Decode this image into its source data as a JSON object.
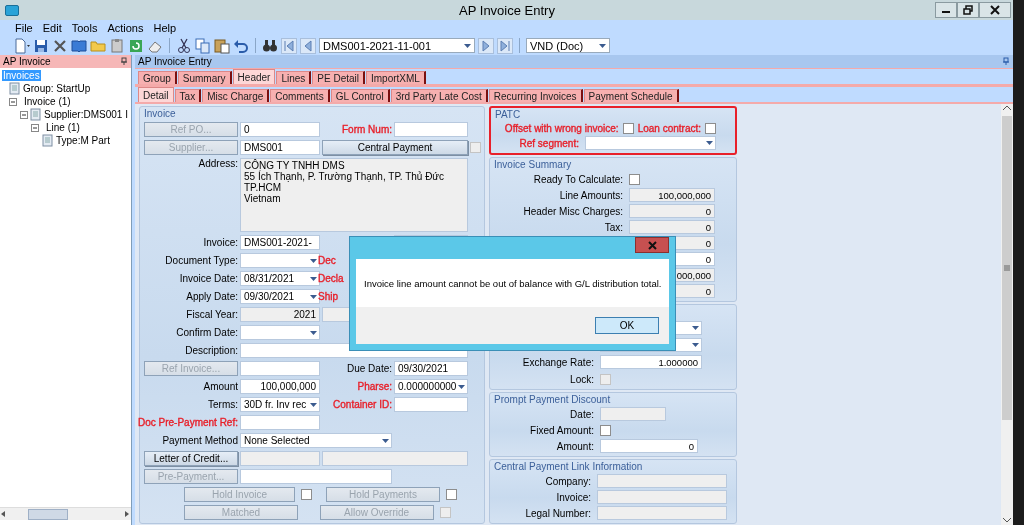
{
  "window": {
    "title": "AP Invoice Entry"
  },
  "menu": [
    "File",
    "Edit",
    "Tools",
    "Actions",
    "Help"
  ],
  "toolbar": {
    "record": "DMS001-2021-11-001",
    "currency": "VND (Doc)"
  },
  "tree_panel": {
    "title": "AP Invoice",
    "items": [
      {
        "label": "Invoices",
        "selected": true,
        "children": [
          {
            "label": "Group: StartUp",
            "kind": "record",
            "selected": false
          },
          {
            "label": "Invoice (1)",
            "kind": "group",
            "selected": false,
            "expanded": true,
            "children": [
              {
                "label": "Supplier:DMS001 I",
                "kind": "record",
                "selected": false,
                "expanded": true,
                "children": [
                  {
                    "label": "Line (1)",
                    "kind": "group",
                    "selected": false,
                    "expanded": true,
                    "children": [
                      {
                        "label": "Type:M Part",
                        "kind": "record",
                        "selected": false
                      }
                    ]
                  }
                ]
              }
            ]
          }
        ]
      }
    ]
  },
  "main": {
    "title": "AP Invoice Entry",
    "tabs": [
      {
        "label": "Group",
        "selected": false
      },
      {
        "label": "Summary",
        "selected": false
      },
      {
        "label": "Header",
        "selected": true
      },
      {
        "label": "Lines",
        "selected": false
      },
      {
        "label": "PE Detail",
        "selected": false
      },
      {
        "label": "ImportXML",
        "selected": false
      }
    ],
    "subtabs": [
      {
        "label": "Detail",
        "selected": true
      },
      {
        "label": "Tax",
        "selected": false
      },
      {
        "label": "Misc Charge",
        "selected": false
      },
      {
        "label": "Comments",
        "selected": false
      },
      {
        "label": "GL Control",
        "selected": false
      },
      {
        "label": "3rd Party Late Cost",
        "selected": false
      },
      {
        "label": "Recurring Invoices",
        "selected": false
      },
      {
        "label": "Payment Schedule",
        "selected": false
      }
    ],
    "invoice_group": {
      "title": "Invoice",
      "rows": [
        {
          "kind": "fields",
          "cells": [
            {
              "kind": "button",
              "text": "Ref PO...",
              "disabled": true
            },
            {
              "kind": "field",
              "value": "0"
            },
            {
              "kind": "label",
              "text": "Form Num:",
              "color": "#e8202a"
            },
            {
              "kind": "field"
            }
          ]
        },
        {
          "kind": "fields",
          "cells": [
            {
              "kind": "button",
              "text": "Supplier...",
              "disabled": true
            },
            {
              "kind": "field",
              "value": "DMS001"
            },
            {
              "kind": "button",
              "text": "Central Payment",
              "disabled": false
            },
            {
              "kind": "checkbox",
              "checked": false,
              "disabled": true
            }
          ]
        },
        {
          "kind": "fields",
          "cells": [
            {
              "kind": "label",
              "text": "Address:"
            },
            {
              "kind": "textarea",
              "lines": [
                "CÔNG TY TNHH DMS",
                "55 Ích Thạnh, P. Trường Thạnh, TP. Thủ Đức",
                "TP.HCM",
                "Vietnam"
              ]
            }
          ]
        },
        {
          "kind": "fields",
          "cells": [
            {
              "kind": "label",
              "text": "Invoice:"
            },
            {
              "kind": "field",
              "value": "DMS001-2021-"
            },
            {
              "kind": "far_field"
            }
          ]
        },
        {
          "kind": "fields",
          "cells": [
            {
              "kind": "label",
              "text": "Document Type:"
            },
            {
              "kind": "combo"
            },
            {
              "kind": "partial_label",
              "text": "Dec",
              "color": "#e8202a"
            }
          ]
        },
        {
          "kind": "fields",
          "cells": [
            {
              "kind": "label",
              "text": "Invoice Date:"
            },
            {
              "kind": "combo",
              "value": "08/31/2021"
            },
            {
              "kind": "partial_label",
              "text": "Decla",
              "color": "#e8202a"
            }
          ]
        },
        {
          "kind": "fields",
          "cells": [
            {
              "kind": "label",
              "text": "Apply Date:"
            },
            {
              "kind": "combo",
              "value": "09/30/2021"
            },
            {
              "kind": "partial_label",
              "text": "Ship",
              "color": "#e8202a"
            }
          ]
        },
        {
          "kind": "fields",
          "cells": [
            {
              "kind": "label",
              "text": "Fiscal Year:"
            },
            {
              "kind": "number_field",
              "value": "2021",
              "disabled": true
            },
            {
              "kind": "field",
              "disabled": true
            }
          ]
        },
        {
          "kind": "fields",
          "cells": [
            {
              "kind": "label",
              "text": "Confirm Date:"
            },
            {
              "kind": "combo"
            }
          ]
        },
        {
          "kind": "fields",
          "cells": [
            {
              "kind": "label",
              "text": "Description:"
            },
            {
              "kind": "wide_field"
            }
          ]
        },
        {
          "kind": "fields",
          "cells": [
            {
              "kind": "button",
              "text": "Ref Invoice...",
              "disabled": true
            },
            {
              "kind": "field"
            },
            {
              "kind": "label",
              "text": "Due Date:"
            },
            {
              "kind": "field",
              "value": "09/30/2021"
            }
          ]
        },
        {
          "kind": "fields",
          "cells": [
            {
              "kind": "label",
              "text": "Amount"
            },
            {
              "kind": "number_field",
              "value": "100,000,000"
            },
            {
              "kind": "label",
              "text": "Pharse:",
              "color": "#e8202a"
            },
            {
              "kind": "combo",
              "value": "0.000000000"
            }
          ]
        },
        {
          "kind": "fields",
          "cells": [
            {
              "kind": "label",
              "text": "Terms:"
            },
            {
              "kind": "combo",
              "value": "30D fr. Inv rec"
            },
            {
              "kind": "label",
              "text": "Container ID:",
              "color": "#e8202a"
            },
            {
              "kind": "field"
            }
          ]
        },
        {
          "kind": "fields",
          "cells": [
            {
              "kind": "label",
              "text": "Doc Pre-Payment Ref:",
              "color": "#e8202a"
            },
            {
              "kind": "field"
            }
          ]
        },
        {
          "kind": "fields",
          "cells": [
            {
              "kind": "label",
              "text": "Payment Method"
            },
            {
              "kind": "long_combo",
              "value": "None Selected"
            }
          ]
        },
        {
          "kind": "fields",
          "cells": [
            {
              "kind": "button",
              "text": "Letter of Credit...",
              "disabled": false
            },
            {
              "kind": "field",
              "disabled": true
            },
            {
              "kind": "long_field",
              "disabled": true
            }
          ]
        },
        {
          "kind": "fields",
          "cells": [
            {
              "kind": "button",
              "text": "Pre-Payment...",
              "disabled": true
            },
            {
              "kind": "long_field"
            }
          ]
        },
        {
          "kind": "buttons",
          "cells": [
            {
              "text": "Hold Invoice",
              "checked": false
            },
            {
              "text": "Hold Payments",
              "checked": false
            }
          ]
        },
        {
          "kind": "buttons",
          "cells": [
            {
              "text": "Matched"
            },
            {
              "text": "Allow Override",
              "checked": false,
              "disabled": true
            }
          ]
        }
      ]
    },
    "right_groups": [
      {
        "title": "PATC",
        "alert": true,
        "rows": [
          [
            {
              "kind": "label",
              "text": "Offset with wrong invoice:",
              "color": "#e8202a"
            },
            {
              "kind": "checkbox",
              "checked": false
            },
            {
              "kind": "label",
              "text": "Loan contract:",
              "color": "#e8202a"
            },
            {
              "kind": "checkbox",
              "checked": false
            }
          ],
          [
            {
              "kind": "label",
              "text": "Ref segment:",
              "color": "#e8202a"
            },
            {
              "kind": "combo"
            }
          ]
        ]
      },
      {
        "title": "Invoice Summary",
        "alert": false,
        "rows": [
          [
            {
              "kind": "label",
              "text": "Ready To Calculate:"
            },
            {
              "kind": "checkbox",
              "checked": false
            }
          ],
          [
            {
              "kind": "label",
              "text": "Line Amounts:"
            },
            {
              "kind": "number_field",
              "value": "100,000,000",
              "disabled": true
            }
          ],
          [
            {
              "kind": "label",
              "text": "Header Misc Charges:"
            },
            {
              "kind": "number_field",
              "value": "0",
              "disabled": true
            }
          ],
          [
            {
              "kind": "label",
              "text": "Tax:"
            },
            {
              "kind": "number_field",
              "value": "0",
              "disabled": true
            }
          ],
          [
            {
              "kind": "number_field",
              "value": "0",
              "disabled": true
            }
          ],
          [
            {
              "kind": "number_field",
              "value": "0"
            }
          ],
          [
            {
              "kind": "number_field",
              "value": ",000,000",
              "disabled": true
            }
          ],
          [
            {
              "kind": "number_field",
              "value": "0",
              "disabled": true
            }
          ]
        ]
      },
      {
        "alert": false,
        "rows": [
          [
            {
              "kind": "combo"
            }
          ],
          [
            {
              "kind": "combo"
            }
          ],
          [
            {
              "kind": "label",
              "text": "Exchange Rate:"
            },
            {
              "kind": "number_field",
              "value": "1.000000"
            }
          ],
          [
            {
              "kind": "label",
              "text": "Lock:"
            },
            {
              "kind": "checkbox",
              "checked": false,
              "disabled": true
            }
          ]
        ]
      },
      {
        "title": "Prompt Payment Discount",
        "alert": false,
        "rows": [
          [
            {
              "kind": "label",
              "text": "Date:"
            },
            {
              "kind": "field",
              "disabled": true
            }
          ],
          [
            {
              "kind": "label",
              "text": "Fixed Amount:"
            },
            {
              "kind": "checkbox",
              "checked": false
            }
          ],
          [
            {
              "kind": "label",
              "text": "Amount:"
            },
            {
              "kind": "number_field",
              "value": "0"
            }
          ]
        ]
      },
      {
        "title": "Central Payment Link Information",
        "alert": false,
        "rows": [
          [
            {
              "kind": "label",
              "text": "Company:"
            },
            {
              "kind": "field",
              "disabled": true
            }
          ],
          [
            {
              "kind": "label",
              "text": "Invoice:"
            },
            {
              "kind": "field",
              "disabled": true
            }
          ],
          [
            {
              "kind": "label",
              "text": "Legal Number:"
            },
            {
              "kind": "field",
              "disabled": true
            }
          ]
        ]
      }
    ]
  },
  "dialog": {
    "message": "Invoice line amount cannot be out of balance with G/L distribution total.",
    "button": "OK"
  }
}
